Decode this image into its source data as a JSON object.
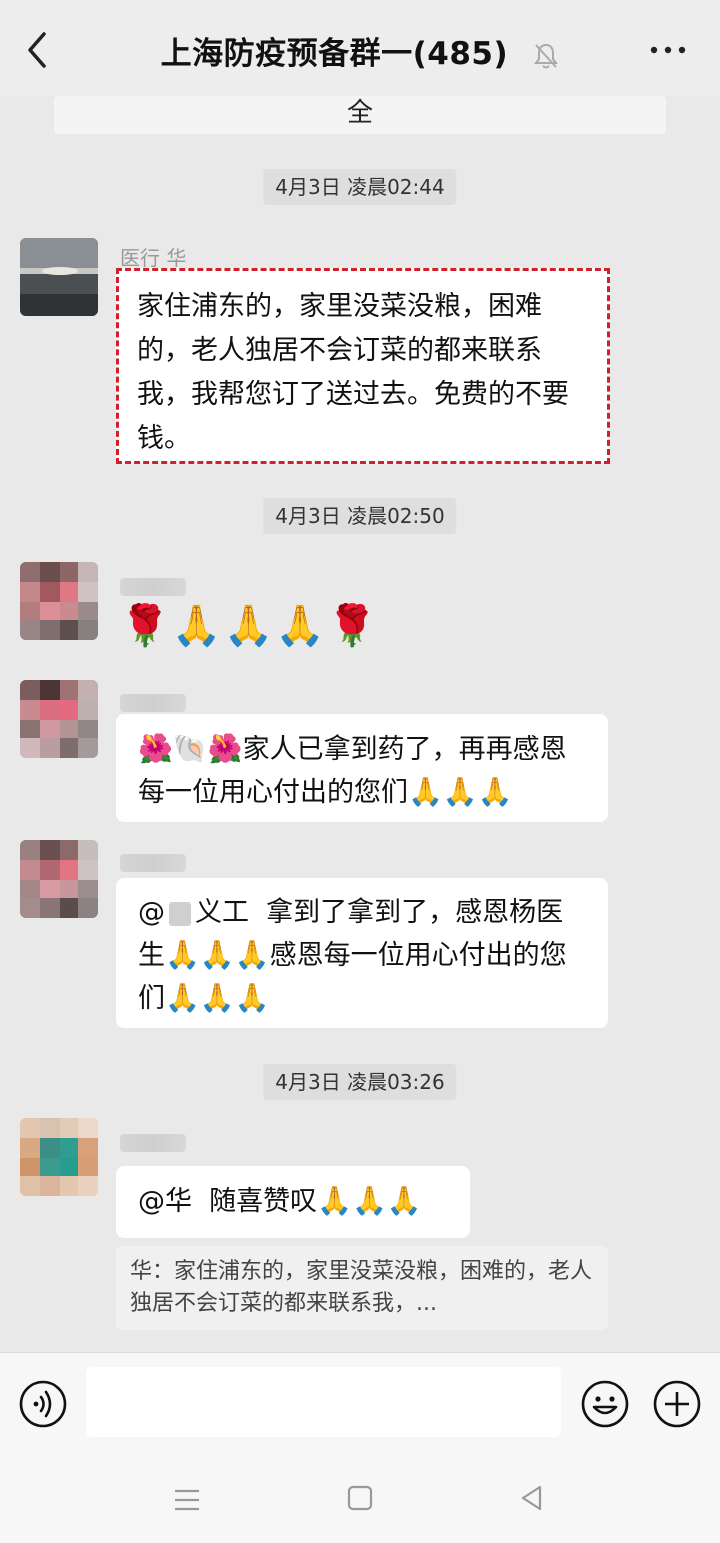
{
  "header": {
    "title": "上海防疫预备群一(485)",
    "muted_icon": "bell-off-icon",
    "back_icon": "chevron-left-icon",
    "more_icon": "more-horizontal-icon"
  },
  "notice": {
    "label": "全"
  },
  "messages": [
    {
      "time": "4月3日 凌晨02:44",
      "sender": "医行 华",
      "text": "家住浦东的，家里没菜没粮，困难的，老人独居不会订菜的都来联系我，我帮您订了送过去。免费的不要钱。"
    },
    {
      "time": "4月3日 凌晨02:50",
      "emoji_line": "🌹🙏🙏🙏🌹"
    },
    {
      "text_prefix_emoji": "🌺🐚🌺",
      "text": "家人已拿到药了，再再感恩每一位用心付出的您们",
      "text_suffix_emoji": "🙏🙏🙏"
    },
    {
      "mention_prefix": "@",
      "mention_name": "义工",
      "text1": "拿到了拿到了，感恩杨医生",
      "emoji1": "🙏🙏🙏",
      "text2": "感恩每一位用心付出的您们",
      "emoji2": "🙏🙏🙏"
    },
    {
      "time": "4月3日 凌晨03:26",
      "mention": "@华",
      "text": "随喜赞叹",
      "emoji": "🙏🙏🙏",
      "quote": "华：家住浦东的，家里没菜没粮，困难的，老人独居不会订菜的都来联系我，..."
    }
  ],
  "input": {
    "value": "",
    "voice_icon": "voice-icon",
    "emoji_icon": "emoji-icon",
    "plus_icon": "plus-circle-icon"
  },
  "nav": {
    "menu_icon": "menu-icon",
    "home_icon": "home-square-icon",
    "back_icon": "back-triangle-icon"
  }
}
